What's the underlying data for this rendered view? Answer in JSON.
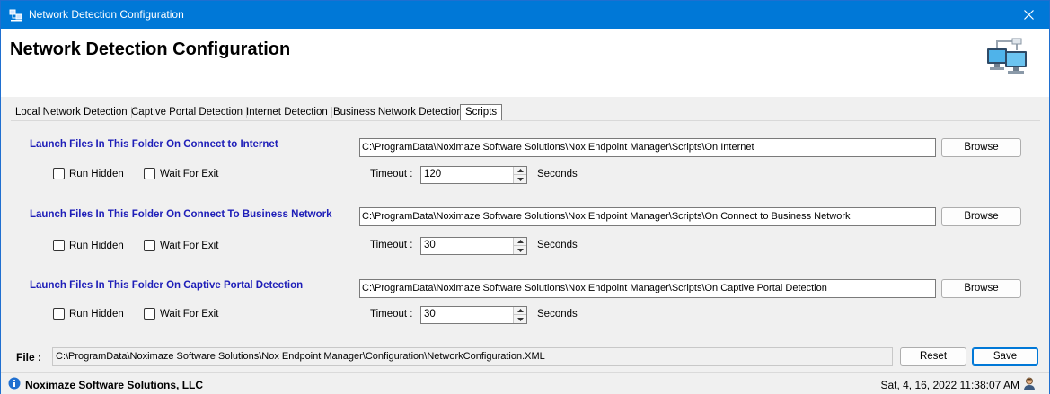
{
  "window": {
    "title": "Network Detection Configuration",
    "accent_color": "#0078d7",
    "close_icon": "close-icon"
  },
  "header": {
    "title": "Network Detection Configuration",
    "icon": "network-computers-icon"
  },
  "tabs": [
    {
      "label": "Local Network Detection",
      "active": false
    },
    {
      "label": "Captive Portal Detection",
      "active": false
    },
    {
      "label": "Internet Detection",
      "active": false
    },
    {
      "label": "Business Network Detection",
      "active": false
    },
    {
      "label": "Scripts",
      "active": true
    }
  ],
  "sections": [
    {
      "title": "Launch Files In This Folder On Connect to Internet",
      "path": "C:\\ProgramData\\Noximaze Software Solutions\\Nox Endpoint Manager\\Scripts\\On Internet",
      "browse_label": "Browse",
      "run_hidden_label": "Run Hidden",
      "run_hidden_checked": false,
      "wait_for_exit_label": "Wait For Exit",
      "wait_for_exit_checked": false,
      "timeout_label": "Timeout :",
      "timeout_value": "120",
      "timeout_unit": "Seconds"
    },
    {
      "title": "Launch Files In This Folder On Connect To Business Network",
      "path": "C:\\ProgramData\\Noximaze Software Solutions\\Nox Endpoint Manager\\Scripts\\On Connect to Business Network",
      "browse_label": "Browse",
      "run_hidden_label": "Run Hidden",
      "run_hidden_checked": false,
      "wait_for_exit_label": "Wait For Exit",
      "wait_for_exit_checked": false,
      "timeout_label": "Timeout :",
      "timeout_value": "30",
      "timeout_unit": "Seconds"
    },
    {
      "title": "Launch Files In This Folder On Captive Portal Detection",
      "path": "C:\\ProgramData\\Noximaze Software Solutions\\Nox Endpoint Manager\\Scripts\\On Captive Portal Detection",
      "browse_label": "Browse",
      "run_hidden_label": "Run Hidden",
      "run_hidden_checked": false,
      "wait_for_exit_label": "Wait For Exit",
      "wait_for_exit_checked": false,
      "timeout_label": "Timeout :",
      "timeout_value": "30",
      "timeout_unit": "Seconds"
    }
  ],
  "section_title_color": "#1e1eb8",
  "file": {
    "label": "File :",
    "path": "C:\\ProgramData\\Noximaze Software Solutions\\Nox Endpoint Manager\\Configuration\\NetworkConfiguration.XML",
    "reset_label": "Reset",
    "save_label": "Save"
  },
  "status": {
    "company": "Noximaze Software Solutions, LLC",
    "datetime": "Sat, 4, 16, 2022 11:38:07 AM",
    "info_icon": "info-icon",
    "user_icon": "user-icon"
  }
}
